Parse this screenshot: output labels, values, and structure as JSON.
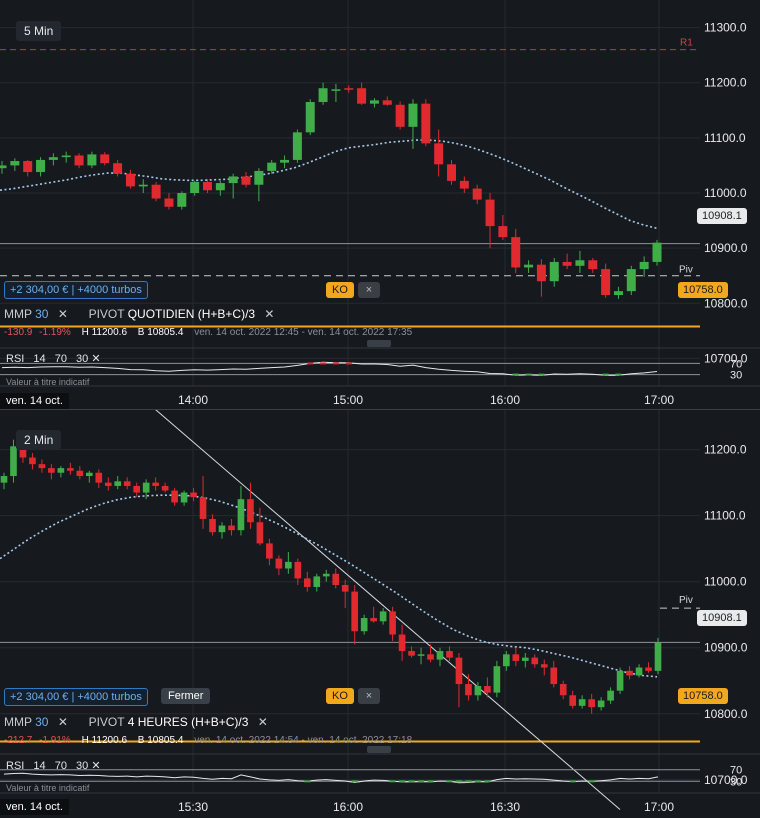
{
  "charts": [
    {
      "timeframe": "5 Min",
      "y_labels": [
        "11300.0",
        "11200.0",
        "11100.0",
        "11000.0",
        "10900.0",
        "10800.0",
        "10700.0"
      ],
      "x_labels": [
        "14:00",
        "15:00",
        "16:00",
        "17:00"
      ],
      "date_label": "ven. 14 oct.",
      "r1_label": "R1",
      "piv_label": "Piv",
      "last_price": "10908.1",
      "ko_price": "10758.0",
      "pnl_text": "+2 304,00 € | +4000 turbos",
      "ko_label": "KO",
      "ko_close": "×",
      "mmp_label": "MMP",
      "mmp_value": "30",
      "pivot_label": "PIVOT",
      "pivot_type": "QUOTIDIEN (H+B+C)/3",
      "change": "-130.9",
      "change_pct": "-1.19%",
      "high_label": "H 11200.6",
      "low_label": "B 10805.4",
      "range_text": "ven. 14 oct. 2022 12:45 - ven. 14 oct. 2022 17:35",
      "rsi_label": "RSI",
      "rsi_params": [
        "14",
        "70",
        "30"
      ],
      "rsi_levels": [
        "70",
        "30"
      ],
      "rsi_sub": "Valeur à titre indicatif"
    },
    {
      "timeframe": "2 Min",
      "y_labels": [
        "11200.0",
        "11100.0",
        "11000.0",
        "10900.0",
        "10800.0",
        "10700.0"
      ],
      "x_labels": [
        "15:30",
        "16:00",
        "16:30",
        "17:00"
      ],
      "date_label": "ven. 14 oct.",
      "piv_label": "Piv",
      "last_price": "10908.1",
      "ko_price": "10758.0",
      "pnl_text": "+2 304,00 € | +4000 turbos",
      "fermer_label": "Fermer",
      "ko_label": "KO",
      "ko_close": "×",
      "mmp_label": "MMP",
      "mmp_value": "30",
      "pivot_label": "PIVOT",
      "pivot_type": "4 HEURES (H+B+C)/3",
      "change": "-212.7",
      "change_pct": "-1.91%",
      "high_label": "H 11200.6",
      "low_label": "B 10805.4",
      "range_text": "ven. 14 oct. 2022 14:54 - ven. 14 oct. 2022 17:18",
      "rsi_label": "RSI",
      "rsi_params": [
        "14",
        "70",
        "30"
      ],
      "rsi_levels": [
        "70",
        "30"
      ],
      "rsi_sub": "Valeur à titre indicatif"
    }
  ],
  "colors": {
    "up": "#3fae49",
    "down": "#e02a2f",
    "ma": "#a8c8e8",
    "ko": "#f2a81d",
    "r1": "#b5403d",
    "grid": "#262b31"
  },
  "chart_data": [
    {
      "type": "candlestick",
      "title": "5 Min",
      "x_ticks": [
        "14:00",
        "15:00",
        "16:00",
        "17:00"
      ],
      "ylim": [
        10650,
        11350
      ],
      "r1": 11260,
      "pivot": 10850,
      "last": 10908.1,
      "ko": 10758,
      "candles": [
        [
          11045,
          11058,
          11035,
          11050
        ],
        [
          11050,
          11063,
          11040,
          11058
        ],
        [
          11058,
          11060,
          11030,
          11038
        ],
        [
          11038,
          11065,
          11030,
          11060
        ],
        [
          11060,
          11072,
          11050,
          11065
        ],
        [
          11065,
          11075,
          11055,
          11068
        ],
        [
          11068,
          11072,
          11045,
          11050
        ],
        [
          11050,
          11075,
          11045,
          11070
        ],
        [
          11070,
          11074,
          11050,
          11054
        ],
        [
          11054,
          11060,
          11030,
          11035
        ],
        [
          11035,
          11042,
          11008,
          11012
        ],
        [
          11012,
          11025,
          11000,
          11015
        ],
        [
          11015,
          11020,
          10985,
          10990
        ],
        [
          10990,
          11000,
          10970,
          10975
        ],
        [
          10975,
          11003,
          10970,
          11000
        ],
        [
          11000,
          11022,
          10995,
          11020
        ],
        [
          11020,
          11025,
          11000,
          11005
        ],
        [
          11005,
          11022,
          10995,
          11018
        ],
        [
          11018,
          11035,
          10990,
          11030
        ],
        [
          11030,
          11038,
          11010,
          11015
        ],
        [
          11015,
          11045,
          10985,
          11040
        ],
        [
          11040,
          11060,
          11035,
          11055
        ],
        [
          11055,
          11068,
          11045,
          11060
        ],
        [
          11060,
          11115,
          11055,
          11110
        ],
        [
          11110,
          11170,
          11105,
          11165
        ],
        [
          11165,
          11200,
          11160,
          11190
        ],
        [
          11188,
          11198,
          11165,
          11188
        ],
        [
          11190,
          11195,
          11182,
          11188
        ],
        [
          11190,
          11200,
          11160,
          11162
        ],
        [
          11162,
          11172,
          11155,
          11168
        ],
        [
          11168,
          11175,
          11158,
          11160
        ],
        [
          11160,
          11166,
          11115,
          11120
        ],
        [
          11120,
          11170,
          11080,
          11162
        ],
        [
          11162,
          11170,
          11085,
          11090
        ],
        [
          11090,
          11115,
          11030,
          11052
        ],
        [
          11052,
          11060,
          11015,
          11022
        ],
        [
          11022,
          11030,
          11000,
          11008
        ],
        [
          11008,
          11015,
          10980,
          10988
        ],
        [
          10988,
          11000,
          10900,
          10940
        ],
        [
          10940,
          10960,
          10915,
          10920
        ],
        [
          10920,
          10935,
          10855,
          10865
        ],
        [
          10865,
          10878,
          10855,
          10870
        ],
        [
          10870,
          10880,
          10812,
          10840
        ],
        [
          10840,
          10882,
          10830,
          10875
        ],
        [
          10875,
          10890,
          10862,
          10868
        ],
        [
          10868,
          10895,
          10855,
          10878
        ],
        [
          10878,
          10882,
          10855,
          10862
        ],
        [
          10862,
          10872,
          10810,
          10815
        ],
        [
          10815,
          10830,
          10808,
          10822
        ],
        [
          10822,
          10868,
          10815,
          10862
        ],
        [
          10862,
          10885,
          10848,
          10875
        ],
        [
          10875,
          10915,
          10868,
          10910
        ]
      ],
      "ma": [
        11005,
        11008,
        11012,
        11016,
        11020,
        11024,
        11029,
        11033,
        11036,
        11036,
        11033,
        11030,
        11026,
        11024,
        11023,
        11023,
        11024,
        11025,
        11028,
        11031,
        11035,
        11040,
        11046,
        11055,
        11065,
        11075,
        11082,
        11085,
        11088,
        11092,
        11094,
        11096,
        11096,
        11094,
        11090,
        11084,
        11076,
        11067,
        11057,
        11046,
        11035,
        11024,
        11011,
        10999,
        10987,
        10974,
        10962,
        10950,
        10942,
        10936
      ],
      "rsi": [
        55,
        56,
        55,
        57,
        58,
        58,
        56,
        57,
        55,
        52,
        48,
        47,
        44,
        42,
        45,
        47,
        46,
        48,
        50,
        49,
        52,
        55,
        57,
        63,
        70,
        74,
        72,
        72,
        68,
        68,
        66,
        60,
        64,
        55,
        49,
        45,
        42,
        40,
        34,
        33,
        28,
        29,
        27,
        32,
        31,
        33,
        31,
        27,
        28,
        33,
        36,
        41
      ],
      "rsi_levels": [
        70,
        30
      ]
    },
    {
      "type": "candlestick",
      "title": "2 Min",
      "x_ticks": [
        "15:30",
        "16:00",
        "16:30",
        "17:00"
      ],
      "ylim": [
        10680,
        11260
      ],
      "pivot": 10960,
      "last": 10908.1,
      "ko": 10758,
      "trendline": [
        [
          10,
          11320
        ],
        [
          620,
          10655
        ]
      ],
      "candles": [
        [
          11150,
          11165,
          11140,
          11160
        ],
        [
          11160,
          11215,
          11150,
          11205
        ],
        [
          11205,
          11212,
          11180,
          11188
        ],
        [
          11188,
          11195,
          11170,
          11178
        ],
        [
          11178,
          11185,
          11165,
          11172
        ],
        [
          11172,
          11178,
          11155,
          11165
        ],
        [
          11165,
          11175,
          11158,
          11172
        ],
        [
          11172,
          11180,
          11162,
          11168
        ],
        [
          11168,
          11175,
          11155,
          11160
        ],
        [
          11160,
          11168,
          11150,
          11165
        ],
        [
          11165,
          11170,
          11142,
          11150
        ],
        [
          11150,
          11158,
          11138,
          11145
        ],
        [
          11145,
          11160,
          11140,
          11152
        ],
        [
          11152,
          11158,
          11140,
          11145
        ],
        [
          11145,
          11150,
          11128,
          11135
        ],
        [
          11135,
          11155,
          11125,
          11150
        ],
        [
          11150,
          11158,
          11138,
          11145
        ],
        [
          11145,
          11150,
          11135,
          11138
        ],
        [
          11138,
          11142,
          11115,
          11120
        ],
        [
          11120,
          11138,
          11115,
          11135
        ],
        [
          11135,
          11142,
          11122,
          11128
        ],
        [
          11128,
          11160,
          11080,
          11095
        ],
        [
          11095,
          11102,
          11070,
          11075
        ],
        [
          11075,
          11090,
          11065,
          11085
        ],
        [
          11085,
          11095,
          11070,
          11078
        ],
        [
          11078,
          11145,
          11070,
          11125
        ],
        [
          11125,
          11150,
          11080,
          11090
        ],
        [
          11090,
          11112,
          11055,
          11058
        ],
        [
          11058,
          11065,
          11025,
          11035
        ],
        [
          11035,
          11040,
          11010,
          11020
        ],
        [
          11020,
          11045,
          11012,
          11030
        ],
        [
          11030,
          11035,
          10995,
          11005
        ],
        [
          11005,
          11015,
          10985,
          10992
        ],
        [
          10992,
          11012,
          10985,
          11008
        ],
        [
          11008,
          11018,
          11000,
          11012
        ],
        [
          11012,
          11020,
          10990,
          10995
        ],
        [
          10995,
          11003,
          10960,
          10985
        ],
        [
          10985,
          10995,
          10905,
          10925
        ],
        [
          10925,
          10950,
          10920,
          10945
        ],
        [
          10945,
          10962,
          10938,
          10940
        ],
        [
          10940,
          10960,
          10935,
          10955
        ],
        [
          10955,
          10962,
          10910,
          10920
        ],
        [
          10920,
          10935,
          10880,
          10895
        ],
        [
          10895,
          10902,
          10885,
          10888
        ],
        [
          10888,
          10900,
          10875,
          10890
        ],
        [
          10890,
          10905,
          10878,
          10882
        ],
        [
          10882,
          10900,
          10872,
          10895
        ],
        [
          10895,
          10902,
          10880,
          10885
        ],
        [
          10885,
          10892,
          10810,
          10845
        ],
        [
          10845,
          10860,
          10820,
          10828
        ],
        [
          10828,
          10848,
          10820,
          10842
        ],
        [
          10842,
          10855,
          10825,
          10832
        ],
        [
          10832,
          10880,
          10825,
          10872
        ],
        [
          10872,
          10895,
          10865,
          10890
        ],
        [
          10890,
          10900,
          10872,
          10880
        ],
        [
          10880,
          10892,
          10870,
          10885
        ],
        [
          10885,
          10890,
          10870,
          10875
        ],
        [
          10875,
          10882,
          10858,
          10870
        ],
        [
          10870,
          10880,
          10840,
          10845
        ],
        [
          10845,
          10850,
          10822,
          10828
        ],
        [
          10828,
          10835,
          10808,
          10812
        ],
        [
          10812,
          10828,
          10808,
          10822
        ],
        [
          10822,
          10830,
          10800,
          10810
        ],
        [
          10810,
          10825,
          10805,
          10820
        ],
        [
          10820,
          10840,
          10815,
          10835
        ],
        [
          10835,
          10870,
          10830,
          10865
        ],
        [
          10865,
          10872,
          10852,
          10858
        ],
        [
          10858,
          10875,
          10855,
          10870
        ],
        [
          10870,
          10878,
          10862,
          10865
        ],
        [
          10865,
          10915,
          10860,
          10908
        ]
      ],
      "ma": [
        11035,
        11050,
        11065,
        11078,
        11090,
        11100,
        11110,
        11118,
        11124,
        11128,
        11130,
        11131,
        11131,
        11130,
        11127,
        11122,
        11115,
        11107,
        11098,
        11088,
        11077,
        11065,
        11053,
        11040,
        11027,
        11013,
        10999,
        10985,
        10970,
        10955,
        10941,
        10928,
        10918,
        10910,
        10905,
        10902,
        10900,
        10896,
        10891,
        10886,
        10880,
        10874,
        10868,
        10862,
        10858,
        10856
      ],
      "rsi": [
        55,
        57,
        58,
        55,
        53,
        52,
        53,
        52,
        50,
        51,
        50,
        48,
        47,
        48,
        45,
        48,
        47,
        45,
        42,
        45,
        44,
        40,
        37,
        40,
        39,
        52,
        45,
        38,
        35,
        33,
        36,
        32,
        30,
        34,
        36,
        33,
        31,
        26,
        31,
        34,
        33,
        30,
        28,
        28,
        29,
        28,
        31,
        30,
        25,
        26,
        29,
        28,
        36,
        40,
        38,
        39,
        38,
        37,
        34,
        31,
        29,
        31,
        30,
        32,
        35,
        40,
        38,
        40,
        39,
        45
      ],
      "rsi_levels": [
        70,
        30
      ]
    }
  ]
}
